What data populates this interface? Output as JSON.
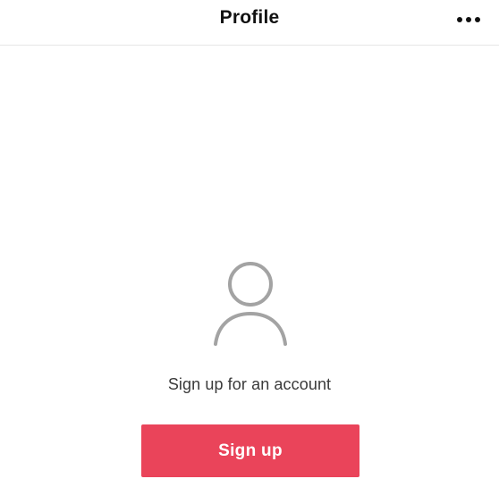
{
  "header": {
    "title": "Profile",
    "more_icon": "more-horizontal-icon"
  },
  "main": {
    "avatar_icon": "user-avatar-icon",
    "prompt": "Sign up for an account",
    "signup_label": "Sign up"
  },
  "colors": {
    "accent": "#ea445a",
    "icon_gray": "#a3a3a3",
    "title": "#111111"
  }
}
